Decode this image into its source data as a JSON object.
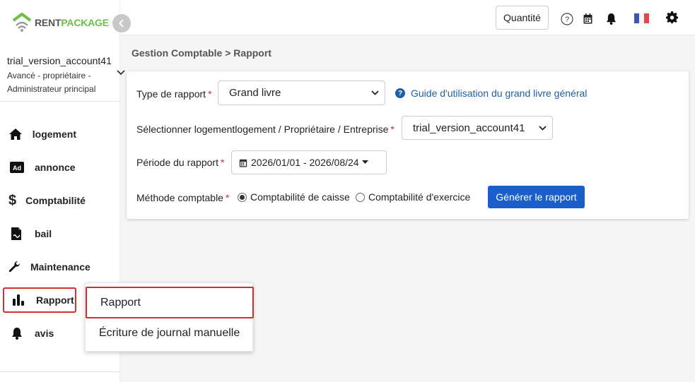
{
  "brand": {
    "part1": "RENT",
    "part2": "PACKAGE",
    "accent": "#6cc04a"
  },
  "account": {
    "name": "trial_version_account41",
    "role_line1": "Avancé - propriétaire -",
    "role_line2": "Administrateur principal"
  },
  "sidebar": {
    "items": [
      {
        "label": "logement",
        "icon": "home-icon"
      },
      {
        "label": "annonce",
        "icon": "ad-icon"
      },
      {
        "label": "Comptabilité",
        "icon": "dollar-icon"
      },
      {
        "label": "bail",
        "icon": "contract-icon"
      },
      {
        "label": "Maintenance",
        "icon": "wrench-icon"
      },
      {
        "label": "Rapport",
        "icon": "bar-chart-icon",
        "active": true
      },
      {
        "label": "avis",
        "icon": "bell-icon"
      }
    ]
  },
  "topbar": {
    "quantity_label": "Quantité"
  },
  "breadcrumb": "Gestion Comptable > Rapport",
  "form": {
    "report_type_label": "Type de rapport",
    "report_type_value": "Grand livre",
    "guide_link": "Guide d'utilisation du grand livre général",
    "property_label": "Sélectionner logementlogement / Propriétaire / Entreprise",
    "property_value": "trial_version_account41",
    "period_label": "Période du rapport",
    "period_value": "2026/01/01 - 2026/08/24",
    "method_label": "Méthode comptable",
    "method_cash": "Comptabilité de caisse",
    "method_accrual": "Comptabilité d'exercice",
    "generate_button": "Générer le rapport"
  },
  "popup_menu": {
    "items": [
      "Rapport",
      "Écriture de journal manuelle"
    ]
  },
  "colors": {
    "primary": "#1a5fc9",
    "highlight": "#d32f2f",
    "link": "#1f5fa8"
  }
}
